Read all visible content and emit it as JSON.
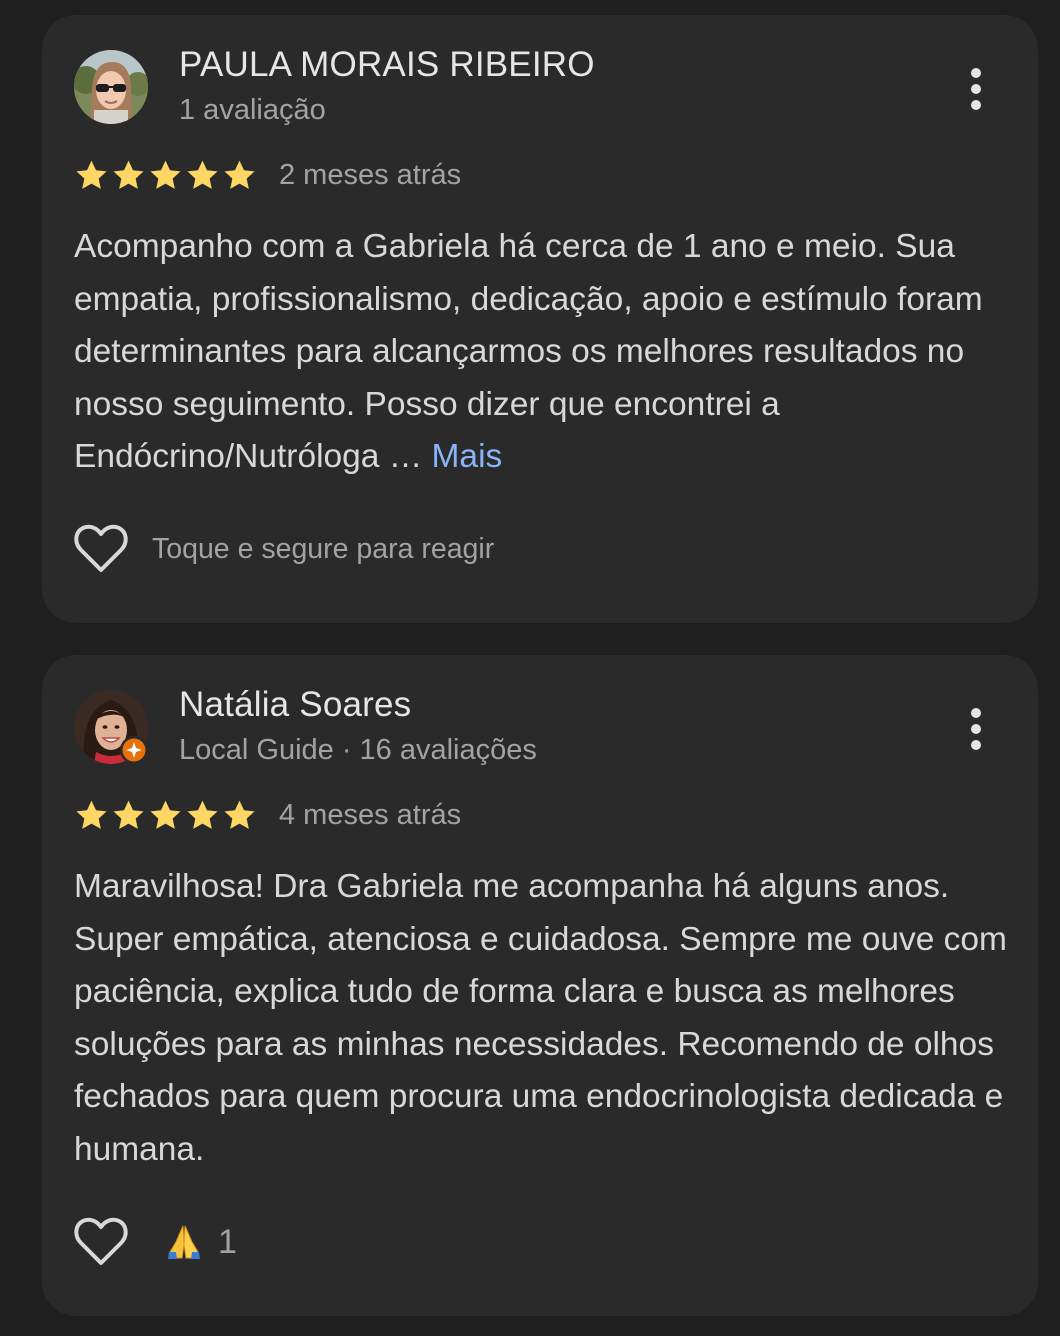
{
  "reviews": [
    {
      "author": "PAULA MORAIS RIBEIRO",
      "meta": "1 avaliação",
      "rating": 5,
      "date": "2 meses atrás",
      "text": "Acompanho com a Gabriela há cerca de 1 ano e meio. Sua empatia, profissionalismo, dedicação, apoio e estímulo foram determinantes para alcançarmos os melhores resultados no nosso seguimento. Posso dizer que encontrei a Endócrino/Nutróloga …",
      "more_label": "Mais",
      "react_hint": "Toque e segure para reagir",
      "avatar_icon": "woman-sunglasses-avatar"
    },
    {
      "author": "Natália Soares",
      "meta": "Local Guide · 16 avaliações",
      "rating": 5,
      "date": "4 meses atrás",
      "text": "Maravilhosa! Dra Gabriela me acompanha há alguns anos. Super empática, atenciosa e cuidadosa. Sempre me ouve com paciência, explica tudo de forma clara e busca as melhores soluções para as minhas necessidades. Recomendo de olhos fechados para quem procura uma endocrinologista dedicada e humana.",
      "reaction_emoji": "folded-hands",
      "reaction_count": "1",
      "avatar_icon": "woman-smiling-avatar",
      "badge_icon": "local-guide-badge"
    }
  ],
  "colors": {
    "background": "#1f1f1f",
    "card": "#2a2a2b",
    "star": "#fdd663",
    "link": "#8ab4f8",
    "local_guide_badge": "#e8710a"
  }
}
